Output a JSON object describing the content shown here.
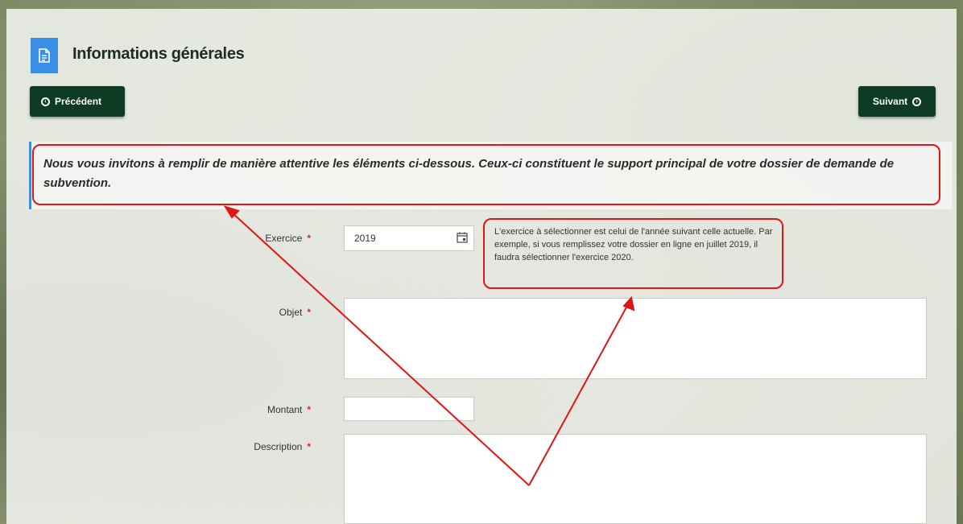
{
  "header": {
    "title": "Informations générales",
    "icon": "document-icon"
  },
  "nav": {
    "prev_label": "Précédent",
    "next_label": "Suivant"
  },
  "intro": "Nous vous invitons à remplir de manière attentive les éléments ci-dessous. Ceux-ci constituent le support principal de votre dossier de demande de subvention.",
  "form": {
    "required_mark": "*",
    "exercice": {
      "label": "Exercice",
      "value": "2019"
    },
    "exercice_hint": "L'exercice à sélectionner est celui de l'année suivant celle actuelle. Par exemple, si vous remplissez votre dossier en ligne en juillet 2019, il faudra sélectionner l'exercice 2020.",
    "objet": {
      "label": "Objet",
      "value": ""
    },
    "montant": {
      "label": "Montant",
      "value": ""
    },
    "description": {
      "label": "Description",
      "value": ""
    }
  },
  "colors": {
    "accent": "#3a8ee6",
    "button": "#0d3b24",
    "annotation": "#e11515",
    "required": "#d12a2a"
  }
}
